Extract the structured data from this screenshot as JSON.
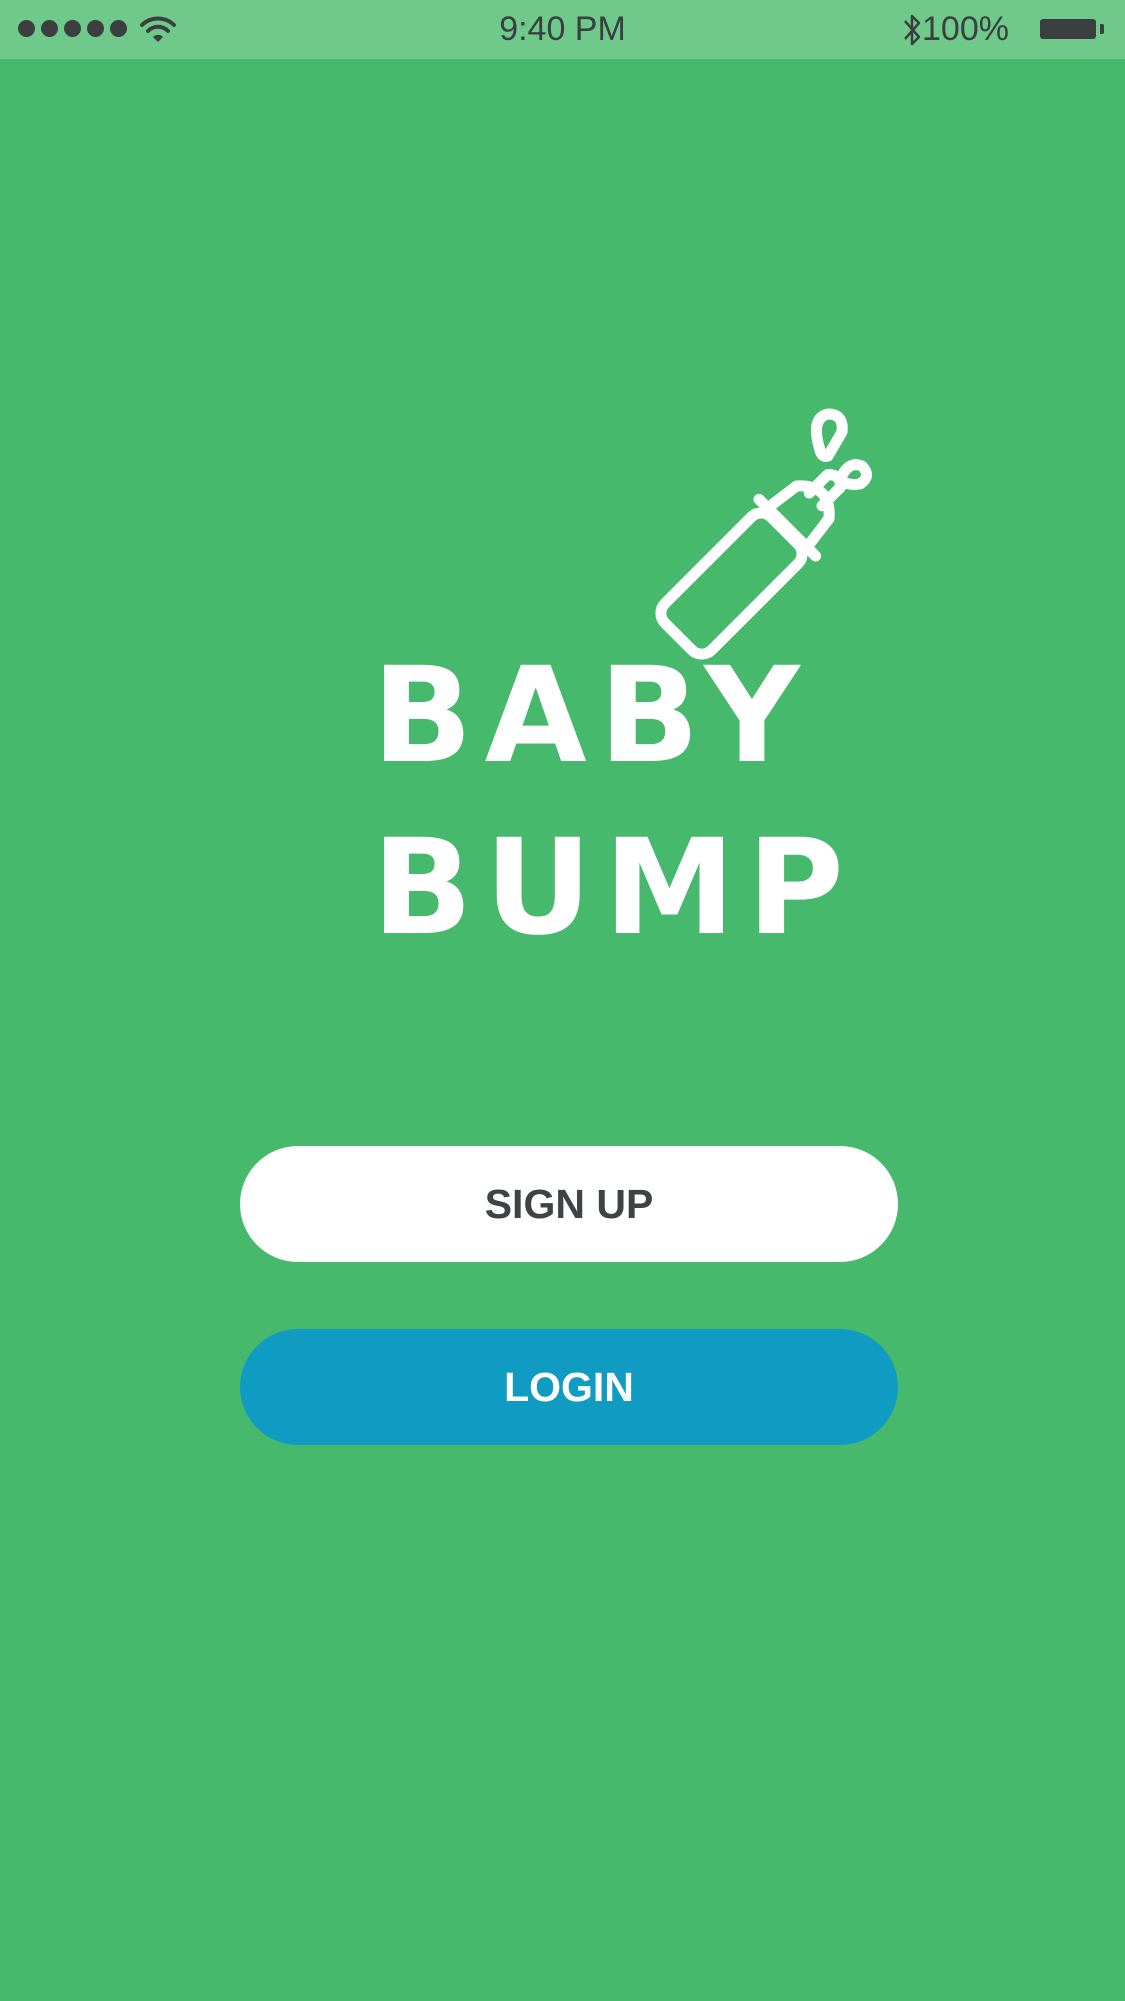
{
  "status_bar": {
    "time": "9:40 PM",
    "battery_percent": "100%",
    "signal_bars": 5,
    "icons": [
      "signal-dots-icon",
      "wifi-icon",
      "bluetooth-icon",
      "battery-icon"
    ]
  },
  "logo": {
    "line1": "BABY",
    "line2": "BUMP",
    "icon": "baby-bottle-icon"
  },
  "actions": {
    "signup_label": "SIGN UP",
    "login_label": "LOGIN"
  },
  "colors": {
    "background": "#46b96d",
    "status_bar": "#6ec98a",
    "signup_bg": "#ffffff",
    "signup_text": "#3e4444",
    "login_bg": "#109cc2",
    "login_text": "#ffffff"
  }
}
